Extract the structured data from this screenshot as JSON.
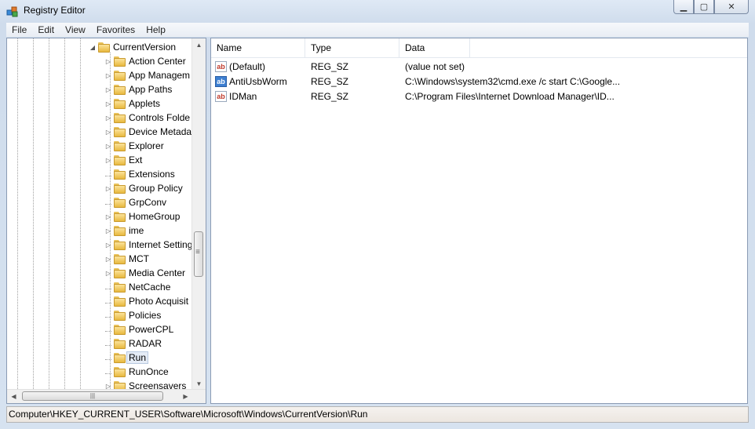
{
  "window": {
    "title": "Registry Editor",
    "icon": "registry-editor-icon"
  },
  "caption_buttons": {
    "minimize": "minimize-icon",
    "maximize": "maximize-icon",
    "close": "close-icon"
  },
  "menu": [
    "File",
    "Edit",
    "View",
    "Favorites",
    "Help"
  ],
  "tree": {
    "parent": "CurrentVersion",
    "items": [
      {
        "label": "Action Center",
        "expandable": true
      },
      {
        "label": "App Managem",
        "expandable": true
      },
      {
        "label": "App Paths",
        "expandable": true
      },
      {
        "label": "Applets",
        "expandable": true
      },
      {
        "label": "Controls Folde",
        "expandable": true
      },
      {
        "label": "Device Metada",
        "expandable": true
      },
      {
        "label": "Explorer",
        "expandable": true
      },
      {
        "label": "Ext",
        "expandable": true
      },
      {
        "label": "Extensions",
        "expandable": false
      },
      {
        "label": "Group Policy",
        "expandable": true
      },
      {
        "label": "GrpConv",
        "expandable": false
      },
      {
        "label": "HomeGroup",
        "expandable": true
      },
      {
        "label": "ime",
        "expandable": true
      },
      {
        "label": "Internet Setting",
        "expandable": true
      },
      {
        "label": "MCT",
        "expandable": true
      },
      {
        "label": "Media Center",
        "expandable": true
      },
      {
        "label": "NetCache",
        "expandable": false
      },
      {
        "label": "Photo Acquisit",
        "expandable": false
      },
      {
        "label": "Policies",
        "expandable": false
      },
      {
        "label": "PowerCPL",
        "expandable": false
      },
      {
        "label": "RADAR",
        "expandable": false
      },
      {
        "label": "Run",
        "expandable": false,
        "selected": true
      },
      {
        "label": "RunOnce",
        "expandable": false
      },
      {
        "label": "Screensavers",
        "expandable": true
      }
    ]
  },
  "values": {
    "columns": [
      "Name",
      "Type",
      "Data"
    ],
    "rows": [
      {
        "name": "(Default)",
        "type": "REG_SZ",
        "data": "(value not set)",
        "icon": "red"
      },
      {
        "name": "AntiUsbWorm",
        "type": "REG_SZ",
        "data": "C:\\Windows\\system32\\cmd.exe /c start C:\\Google...",
        "icon": "blue"
      },
      {
        "name": "IDMan",
        "type": "REG_SZ",
        "data": "C:\\Program Files\\Internet Download Manager\\ID...",
        "icon": "red"
      }
    ]
  },
  "status": "Computer\\HKEY_CURRENT_USER\\Software\\Microsoft\\Windows\\CurrentVersion\\Run"
}
